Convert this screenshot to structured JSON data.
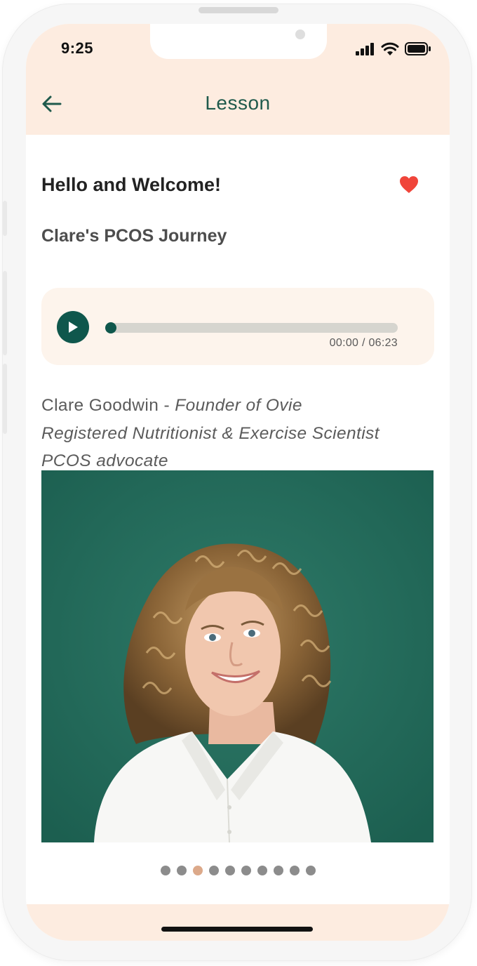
{
  "status_bar": {
    "time": "9:25",
    "icons": [
      "cellular-signal-icon",
      "wifi-icon",
      "battery-icon"
    ]
  },
  "header": {
    "title": "Lesson",
    "back_icon": "arrow-left-icon"
  },
  "lesson": {
    "title": "Hello and Welcome!",
    "subtitle": "Clare's PCOS Journey",
    "favorite_icon": "heart-icon",
    "favorited": true
  },
  "audio": {
    "current_time": "00:00",
    "duration": "06:23",
    "time_label": "00:00 / 06:23",
    "progress": 0,
    "play_icon": "play-icon"
  },
  "bio": {
    "name": "Clare Goodwin",
    "separator": " - ",
    "role": "Founder of Ovie",
    "line2": "Registered Nutritionist & Exercise Scientist",
    "line3": "PCOS advocate"
  },
  "carousel": {
    "total": 10,
    "active_index": 2
  },
  "colors": {
    "accent": "#0f574c",
    "header_bg": "#fdece0",
    "audio_card_bg": "#fdf4ec",
    "heart": "#f0453a",
    "dot_active": "#dca98a",
    "dot_inactive": "#8c8c8c",
    "photo_bg": "#236b5b"
  }
}
